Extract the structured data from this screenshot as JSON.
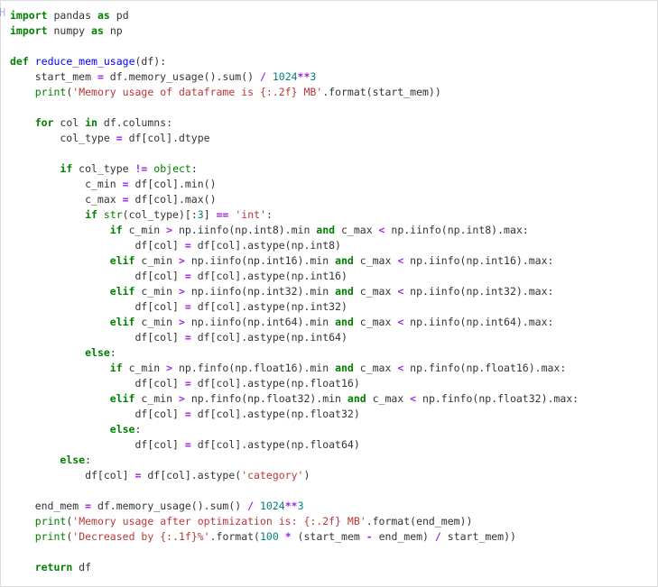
{
  "gutter_marker": "H",
  "code": {
    "import1_kw": "import",
    "import1_mod": "pandas",
    "import1_as": "as",
    "import1_alias": "pd",
    "import2_kw": "import",
    "import2_mod": "numpy",
    "import2_as": "as",
    "import2_alias": "np",
    "def_kw": "def",
    "def_name": "reduce_mem_usage",
    "def_params": "(df):",
    "l1_a": "    start_mem ",
    "l1_op": "=",
    "l1_b": " df.memory_usage().sum() ",
    "l1_div": "/",
    "l1_sp": " ",
    "l1_n1": "1024",
    "l1_pow": "**",
    "l1_n2": "3",
    "l2_a": "    ",
    "l2_print": "print",
    "l2_op": "(",
    "l2_str": "'Memory usage of dataframe is {:.2f} MB'",
    "l2_b": ".format(start_mem))",
    "for_kw": "for",
    "for_a": " col ",
    "in_kw": "in",
    "for_b": " df.columns:",
    "l3": "        col_type ",
    "l3_op": "=",
    "l3b": " df[col].dtype",
    "if1_kw": "if",
    "if1_a": " col_type ",
    "if1_ne": "!=",
    "if1_sp": " ",
    "if1_obj": "object",
    "if1_c": ":",
    "l4": "            c_min ",
    "l4_eq": "=",
    "l4b": " df[col].min()",
    "l5": "            c_max ",
    "l5_eq": "=",
    "l5b": " df[col].max()",
    "if2_kw": "if",
    "if2_pre": " ",
    "if2_str": "str",
    "if2_a": "(col_type)[:",
    "if2_n": "3",
    "if2_b": "] ",
    "if2_eq": "==",
    "if2_sp": " ",
    "if2_s": "'int'",
    "if2_c": ":",
    "i8_if": "if",
    "i8_a": " c_min ",
    "i8_gt": ">",
    "i8_b": " np.iinfo(np.int8).min ",
    "i8_and": "and",
    "i8_c": " c_max ",
    "i8_lt": "<",
    "i8_d": " np.iinfo(np.int8).max:",
    "i8_assign_a": "                    df[col] ",
    "i8_eq": "=",
    "i8_assign_b": " df[col].astype(np.int8)",
    "i16_if": "elif",
    "i16_a": " c_min ",
    "i16_gt": ">",
    "i16_b": " np.iinfo(np.int16).min ",
    "i16_and": "and",
    "i16_c": " c_max ",
    "i16_lt": "<",
    "i16_d": " np.iinfo(np.int16).max:",
    "i16_assign_a": "                    df[col] ",
    "i16_eq": "=",
    "i16_assign_b": " df[col].astype(np.int16)",
    "i32_if": "elif",
    "i32_a": " c_min ",
    "i32_gt": ">",
    "i32_b": " np.iinfo(np.int32).min ",
    "i32_and": "and",
    "i32_c": " c_max ",
    "i32_lt": "<",
    "i32_d": " np.iinfo(np.int32).max:",
    "i32_assign_a": "                    df[col] ",
    "i32_eq": "=",
    "i32_assign_b": " df[col].astype(np.int32)",
    "i64_if": "elif",
    "i64_a": " c_min ",
    "i64_gt": ">",
    "i64_b": " np.iinfo(np.int64).min ",
    "i64_and": "and",
    "i64_c": " c_max ",
    "i64_lt": "<",
    "i64_d": " np.iinfo(np.int64).max:",
    "i64_assign_a": "                    df[col] ",
    "i64_eq": "=",
    "i64_assign_b": " df[col].astype(np.int64)",
    "else1": "else",
    "else1c": ":",
    "f16_if": "if",
    "f16_a": " c_min ",
    "f16_gt": ">",
    "f16_b": " np.finfo(np.float16).min ",
    "f16_and": "and",
    "f16_c": " c_max ",
    "f16_lt": "<",
    "f16_d": " np.finfo(np.float16).max:",
    "f16_assign_a": "                    df[col] ",
    "f16_eq": "=",
    "f16_assign_b": " df[col].astype(np.float16)",
    "f32_if": "elif",
    "f32_a": " c_min ",
    "f32_gt": ">",
    "f32_b": " np.finfo(np.float32).min ",
    "f32_and": "and",
    "f32_c": " c_max ",
    "f32_lt": "<",
    "f32_d": " np.finfo(np.float32).max:",
    "f32_assign_a": "                    df[col] ",
    "f32_eq": "=",
    "f32_assign_b": " df[col].astype(np.float32)",
    "else2": "else",
    "else2c": ":",
    "f64_assign_a": "                    df[col] ",
    "f64_eq": "=",
    "f64_assign_b": " df[col].astype(np.float64)",
    "else3": "else",
    "else3c": ":",
    "cat_a": "            df[col] ",
    "cat_eq": "=",
    "cat_b": " df[col].astype(",
    "cat_s": "'category'",
    "cat_c": ")",
    "end_a": "    end_mem ",
    "end_eq": "=",
    "end_b": " df.memory_usage().sum() ",
    "end_div": "/",
    "end_sp": " ",
    "end_n1": "1024",
    "end_pow": "**",
    "end_n2": "3",
    "p2_a": "    ",
    "p2_print": "print",
    "p2_op": "(",
    "p2_str": "'Memory usage after optimization is: {:.2f} MB'",
    "p2_b": ".format(end_mem))",
    "p3_a": "    ",
    "p3_print": "print",
    "p3_op": "(",
    "p3_str": "'Decreased by {:.1f}%'",
    "p3_b": ".format(",
    "p3_n": "100",
    "p3_c": " ",
    "p3_mul": "*",
    "p3_d": " (start_mem ",
    "p3_min": "-",
    "p3_e": " end_mem) ",
    "p3_div": "/",
    "p3_f": " start_mem))",
    "ret_kw": "return",
    "ret_a": " df"
  }
}
